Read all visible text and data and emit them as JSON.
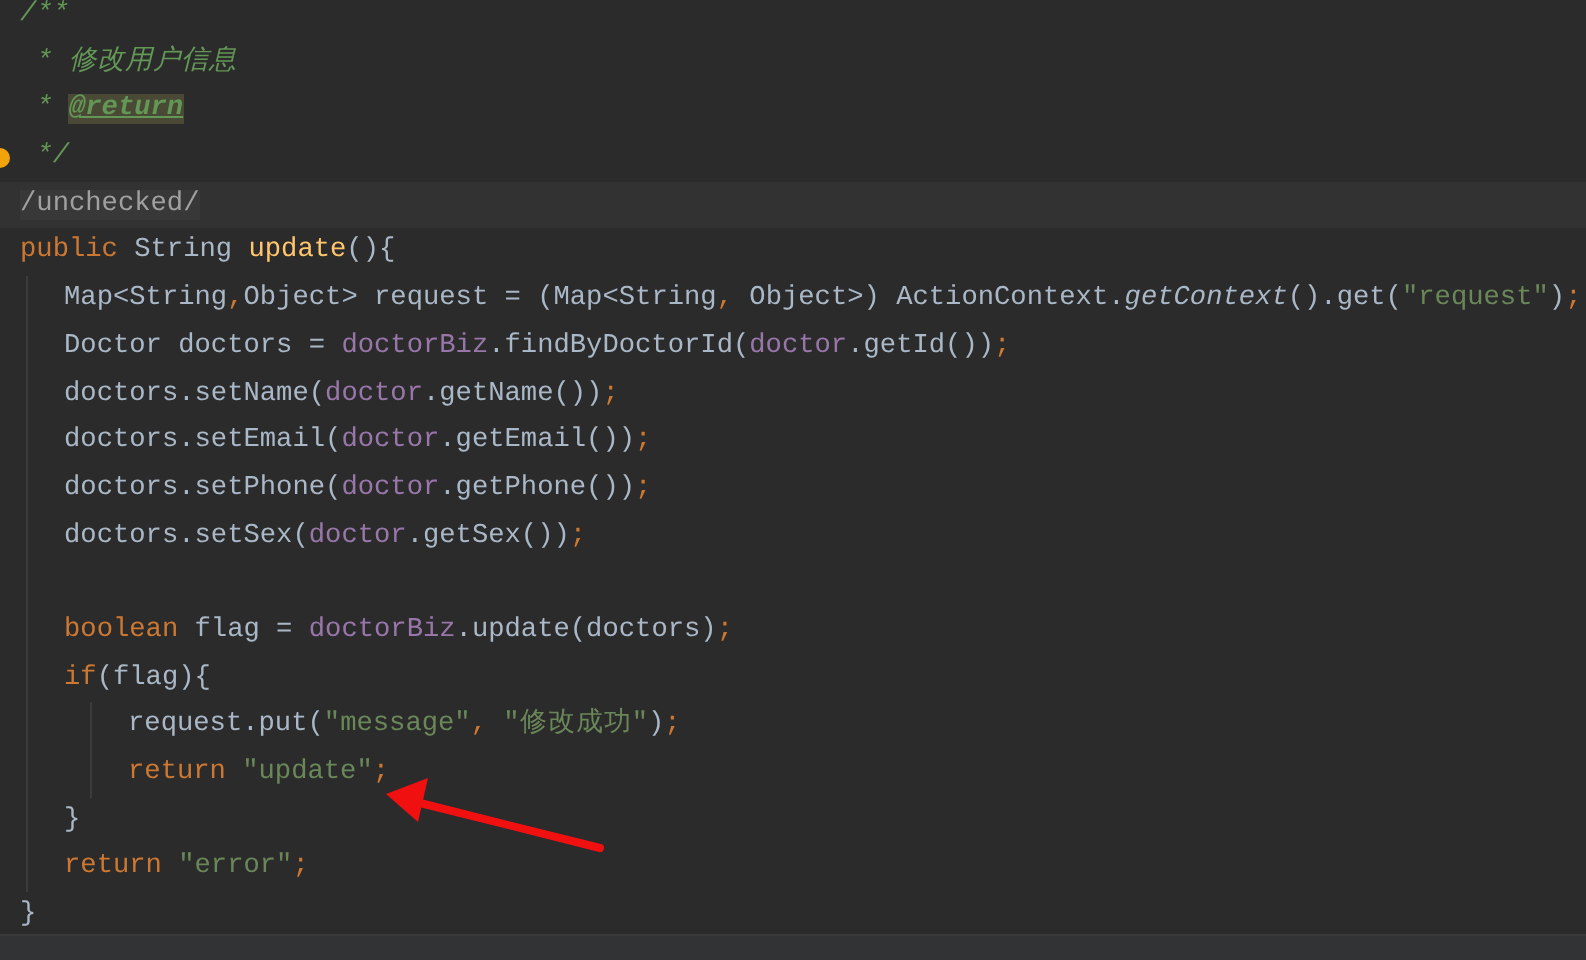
{
  "editor": {
    "lines": [
      {
        "kind": "code",
        "tokens": [
          {
            "kind": "comment",
            "text": "/**"
          }
        ]
      },
      {
        "kind": "code",
        "tokens": [
          {
            "kind": "comment",
            "text": " * 修改用户信息"
          }
        ]
      },
      {
        "kind": "code",
        "tokens": [
          {
            "kind": "comment",
            "text": " * "
          },
          {
            "kind": "doctag",
            "text": "@return"
          }
        ]
      },
      {
        "kind": "code",
        "gutter_mark": true,
        "tokens": [
          {
            "kind": "comment",
            "text": " */"
          }
        ]
      },
      {
        "kind": "current",
        "tokens": [
          {
            "kind": "annotation",
            "text": "/unchecked/"
          }
        ]
      },
      {
        "kind": "code",
        "tokens": [
          {
            "kind": "keyword",
            "text": "public "
          },
          {
            "kind": "plain",
            "text": "String "
          },
          {
            "kind": "method",
            "text": "update"
          },
          {
            "kind": "plain",
            "text": "(){"
          }
        ],
        "children": [
          {
            "kind": "code",
            "tokens": [
              {
                "kind": "plain",
                "text": "Map<String"
              },
              {
                "kind": "punct",
                "text": ","
              },
              {
                "kind": "plain",
                "text": "Object> request = (Map<String"
              },
              {
                "kind": "punct",
                "text": ", "
              },
              {
                "kind": "plain",
                "text": "Object>) ActionContext."
              },
              {
                "kind": "static",
                "text": "getContext"
              },
              {
                "kind": "plain",
                "text": "().get("
              },
              {
                "kind": "string",
                "text": "\"request\""
              },
              {
                "kind": "plain",
                "text": ")"
              },
              {
                "kind": "punct",
                "text": ";"
              }
            ]
          },
          {
            "kind": "code",
            "tokens": [
              {
                "kind": "plain",
                "text": "Doctor doctors = "
              },
              {
                "kind": "field",
                "text": "doctorBiz"
              },
              {
                "kind": "plain",
                "text": ".findByDoctorId("
              },
              {
                "kind": "field",
                "text": "doctor"
              },
              {
                "kind": "plain",
                "text": ".getId())"
              },
              {
                "kind": "punct",
                "text": ";"
              }
            ]
          },
          {
            "kind": "code",
            "tokens": [
              {
                "kind": "plain",
                "text": "doctors.setName("
              },
              {
                "kind": "field",
                "text": "doctor"
              },
              {
                "kind": "plain",
                "text": ".getName())"
              },
              {
                "kind": "punct",
                "text": ";"
              }
            ]
          },
          {
            "kind": "code",
            "tokens": [
              {
                "kind": "plain",
                "text": "doctors.setEmail("
              },
              {
                "kind": "field",
                "text": "doctor"
              },
              {
                "kind": "plain",
                "text": ".getEmail())"
              },
              {
                "kind": "punct",
                "text": ";"
              }
            ]
          },
          {
            "kind": "code",
            "tokens": [
              {
                "kind": "plain",
                "text": "doctors.setPhone("
              },
              {
                "kind": "field",
                "text": "doctor"
              },
              {
                "kind": "plain",
                "text": ".getPhone())"
              },
              {
                "kind": "punct",
                "text": ";"
              }
            ]
          },
          {
            "kind": "code",
            "tokens": [
              {
                "kind": "plain",
                "text": "doctors.setSex("
              },
              {
                "kind": "field",
                "text": "doctor"
              },
              {
                "kind": "plain",
                "text": ".getSex())"
              },
              {
                "kind": "punct",
                "text": ";"
              }
            ]
          },
          {
            "kind": "blank"
          },
          {
            "kind": "code",
            "tokens": [
              {
                "kind": "keyword",
                "text": "boolean "
              },
              {
                "kind": "plain",
                "text": "flag = "
              },
              {
                "kind": "field",
                "text": "doctorBiz"
              },
              {
                "kind": "plain",
                "text": ".update(doctors)"
              },
              {
                "kind": "punct",
                "text": ";"
              }
            ]
          },
          {
            "kind": "code",
            "tokens": [
              {
                "kind": "keyword",
                "text": "if"
              },
              {
                "kind": "plain",
                "text": "(flag){"
              }
            ],
            "children": [
              {
                "kind": "code",
                "tokens": [
                  {
                    "kind": "plain",
                    "text": "request.put("
                  },
                  {
                    "kind": "string",
                    "text": "\"message\""
                  },
                  {
                    "kind": "punct",
                    "text": ", "
                  },
                  {
                    "kind": "string",
                    "text": "\"修改成功\""
                  },
                  {
                    "kind": "plain",
                    "text": ")"
                  },
                  {
                    "kind": "punct",
                    "text": ";"
                  }
                ]
              },
              {
                "kind": "code",
                "tokens": [
                  {
                    "kind": "keyword",
                    "text": "return "
                  },
                  {
                    "kind": "string",
                    "text": "\"update\""
                  },
                  {
                    "kind": "punct",
                    "text": ";"
                  }
                ]
              }
            ]
          },
          {
            "kind": "code",
            "tokens": [
              {
                "kind": "plain",
                "text": "}"
              }
            ]
          },
          {
            "kind": "code",
            "tokens": [
              {
                "kind": "keyword",
                "text": "return "
              },
              {
                "kind": "string",
                "text": "\"error\""
              },
              {
                "kind": "punct",
                "text": ";"
              }
            ]
          }
        ]
      },
      {
        "kind": "code",
        "tokens": [
          {
            "kind": "plain",
            "text": "}"
          }
        ]
      }
    ]
  }
}
